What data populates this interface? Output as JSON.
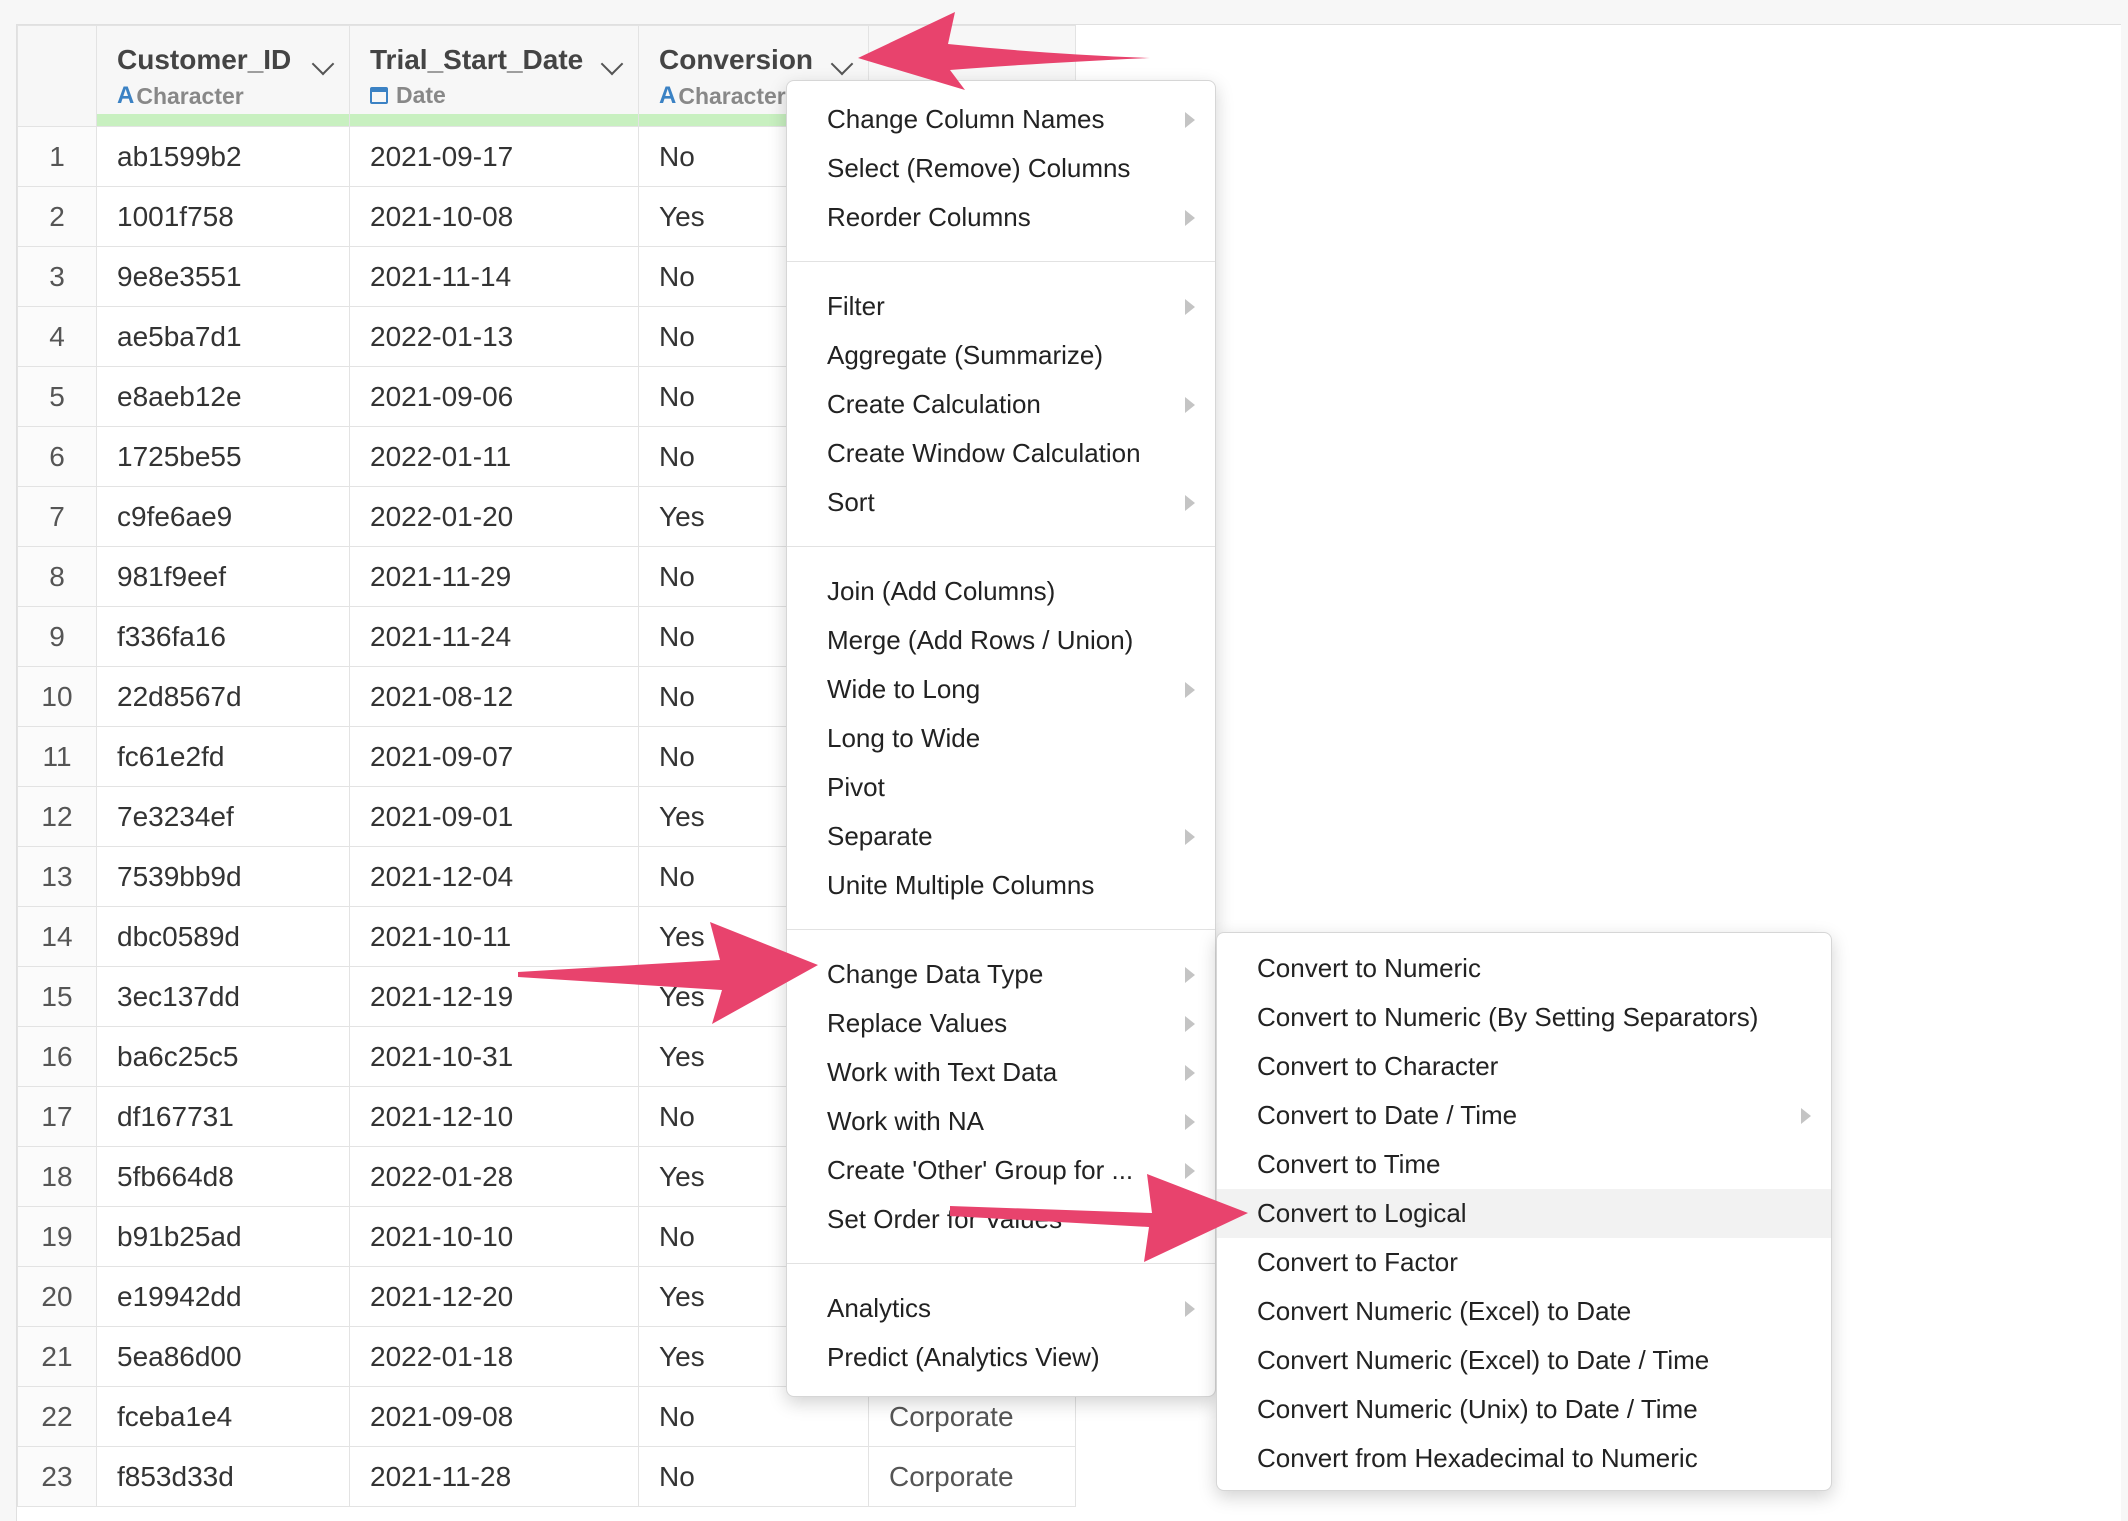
{
  "columns": [
    {
      "name": "Customer_ID",
      "type": "Character",
      "type_icon": "A"
    },
    {
      "name": "Trial_Start_Date",
      "type": "Date",
      "type_icon": "calendar-icon"
    },
    {
      "name": "Conversion",
      "type": "Character",
      "type_icon": "A"
    },
    {
      "name": "",
      "type": "",
      "type_icon": ""
    }
  ],
  "rows": [
    {
      "n": "1",
      "id": "ab1599b2",
      "date": "2021-09-17",
      "conv": "No",
      "cat": ""
    },
    {
      "n": "2",
      "id": "1001f758",
      "date": "2021-10-08",
      "conv": "Yes",
      "cat": ""
    },
    {
      "n": "3",
      "id": "9e8e3551",
      "date": "2021-11-14",
      "conv": "No",
      "cat": ""
    },
    {
      "n": "4",
      "id": "ae5ba7d1",
      "date": "2022-01-13",
      "conv": "No",
      "cat": ""
    },
    {
      "n": "5",
      "id": "e8aeb12e",
      "date": "2021-09-06",
      "conv": "No",
      "cat": ""
    },
    {
      "n": "6",
      "id": "1725be55",
      "date": "2022-01-11",
      "conv": "No",
      "cat": ""
    },
    {
      "n": "7",
      "id": "c9fe6ae9",
      "date": "2022-01-20",
      "conv": "Yes",
      "cat": ""
    },
    {
      "n": "8",
      "id": "981f9eef",
      "date": "2021-11-29",
      "conv": "No",
      "cat": ""
    },
    {
      "n": "9",
      "id": "f336fa16",
      "date": "2021-11-24",
      "conv": "No",
      "cat": ""
    },
    {
      "n": "10",
      "id": "22d8567d",
      "date": "2021-08-12",
      "conv": "No",
      "cat": ""
    },
    {
      "n": "11",
      "id": "fc61e2fd",
      "date": "2021-09-07",
      "conv": "No",
      "cat": ""
    },
    {
      "n": "12",
      "id": "7e3234ef",
      "date": "2021-09-01",
      "conv": "Yes",
      "cat": ""
    },
    {
      "n": "13",
      "id": "7539bb9d",
      "date": "2021-12-04",
      "conv": "No",
      "cat": ""
    },
    {
      "n": "14",
      "id": "dbc0589d",
      "date": "2021-10-11",
      "conv": "Yes",
      "cat": ""
    },
    {
      "n": "15",
      "id": "3ec137dd",
      "date": "2021-12-19",
      "conv": "Yes",
      "cat": ""
    },
    {
      "n": "16",
      "id": "ba6c25c5",
      "date": "2021-10-31",
      "conv": "Yes",
      "cat": ""
    },
    {
      "n": "17",
      "id": "df167731",
      "date": "2021-12-10",
      "conv": "No",
      "cat": ""
    },
    {
      "n": "18",
      "id": "5fb664d8",
      "date": "2022-01-28",
      "conv": "Yes",
      "cat": ""
    },
    {
      "n": "19",
      "id": "b91b25ad",
      "date": "2021-10-10",
      "conv": "No",
      "cat": ""
    },
    {
      "n": "20",
      "id": "e19942dd",
      "date": "2021-12-20",
      "conv": "Yes",
      "cat": ""
    },
    {
      "n": "21",
      "id": "5ea86d00",
      "date": "2022-01-18",
      "conv": "Yes",
      "cat": ""
    },
    {
      "n": "22",
      "id": "fceba1e4",
      "date": "2021-09-08",
      "conv": "No",
      "cat": "Corporate"
    },
    {
      "n": "23",
      "id": "f853d33d",
      "date": "2021-11-28",
      "conv": "No",
      "cat": "Corporate"
    }
  ],
  "column_menu": {
    "groups": [
      [
        {
          "label": "Change Column Names",
          "submenu": true
        },
        {
          "label": "Select (Remove) Columns",
          "submenu": false
        },
        {
          "label": "Reorder Columns",
          "submenu": true
        }
      ],
      [
        {
          "label": "Filter",
          "submenu": true
        },
        {
          "label": "Aggregate (Summarize)",
          "submenu": false
        },
        {
          "label": "Create Calculation",
          "submenu": true
        },
        {
          "label": "Create Window Calculation",
          "submenu": false
        },
        {
          "label": "Sort",
          "submenu": true
        }
      ],
      [
        {
          "label": "Join (Add Columns)",
          "submenu": false
        },
        {
          "label": "Merge (Add Rows / Union)",
          "submenu": false
        },
        {
          "label": "Wide to Long",
          "submenu": true
        },
        {
          "label": "Long to Wide",
          "submenu": false
        },
        {
          "label": "Pivot",
          "submenu": false
        },
        {
          "label": "Separate",
          "submenu": true
        },
        {
          "label": "Unite Multiple Columns",
          "submenu": false
        }
      ],
      [
        {
          "label": "Change Data Type",
          "submenu": true
        },
        {
          "label": "Replace Values",
          "submenu": true
        },
        {
          "label": "Work with Text Data",
          "submenu": true
        },
        {
          "label": "Work with NA",
          "submenu": true
        },
        {
          "label": "Create 'Other' Group for ...",
          "submenu": true
        },
        {
          "label": "Set Order for Values",
          "submenu": false
        }
      ],
      [
        {
          "label": "Analytics",
          "submenu": true
        },
        {
          "label": "Predict (Analytics View)",
          "submenu": false
        }
      ]
    ]
  },
  "data_type_submenu": [
    {
      "label": "Convert to Numeric",
      "submenu": false
    },
    {
      "label": "Convert to Numeric (By Setting Separators)",
      "submenu": false
    },
    {
      "label": "Convert to Character",
      "submenu": false
    },
    {
      "label": "Convert to Date / Time",
      "submenu": true
    },
    {
      "label": "Convert to Time",
      "submenu": false
    },
    {
      "label": "Convert to Logical",
      "submenu": false,
      "highlighted": true
    },
    {
      "label": "Convert to Factor",
      "submenu": false
    },
    {
      "label": "Convert Numeric (Excel) to Date",
      "submenu": false
    },
    {
      "label": "Convert Numeric (Excel) to Date / Time",
      "submenu": false
    },
    {
      "label": "Convert Numeric (Unix) to Date / Time",
      "submenu": false
    },
    {
      "label": "Convert from Hexadecimal to Numeric",
      "submenu": false
    }
  ],
  "colors": {
    "arrow": "#e8436d",
    "accent": "#3b82c4",
    "quality_bar": "#c8f0c0"
  }
}
